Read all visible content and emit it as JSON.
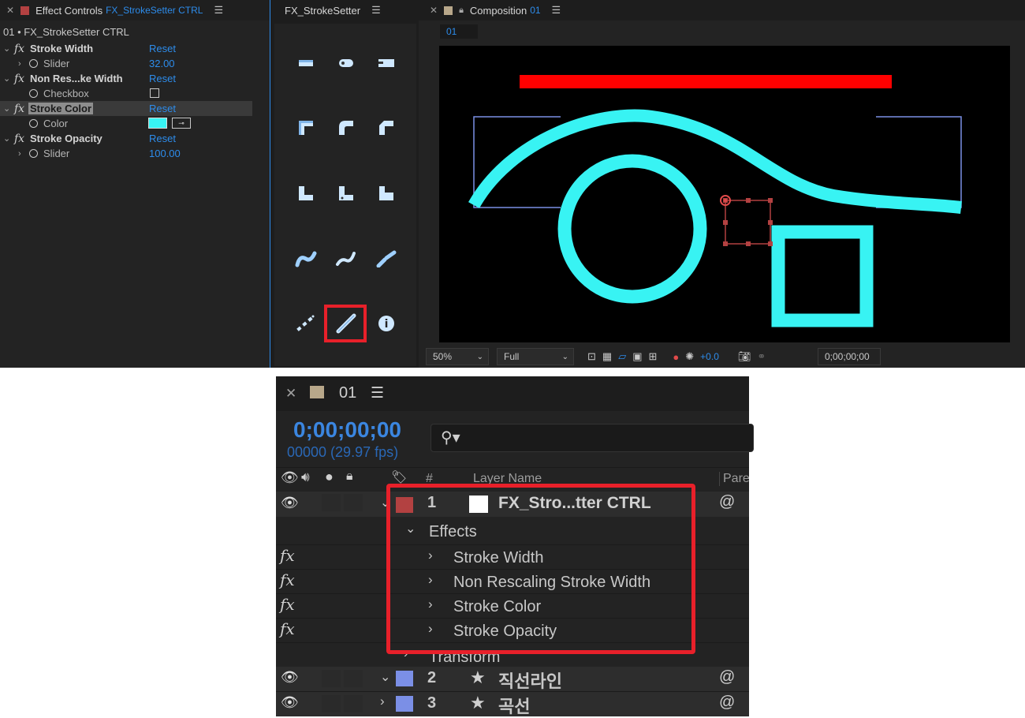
{
  "effect_controls": {
    "tab_label": "Effect Controls",
    "tab_layer": "FX_StrokeSetter CTRL",
    "layer_path": "01 • FX_StrokeSetter CTRL",
    "effects": [
      {
        "name": "Stroke Width",
        "reset": "Reset",
        "param": "Slider",
        "value": "32.00"
      },
      {
        "name": "Non Res...ke Width",
        "reset": "Reset",
        "param": "Checkbox",
        "value": ""
      },
      {
        "name": "Stroke Color",
        "reset": "Reset",
        "param": "Color",
        "value": ""
      },
      {
        "name": "Stroke Opacity",
        "reset": "Reset",
        "param": "Slider",
        "value": "100.00"
      }
    ],
    "color_swatch": "#38f3f3"
  },
  "fx_panel": {
    "title": "FX_StrokeSetter",
    "tools": [
      "cap-butt-icon",
      "cap-round-icon",
      "cap-square-icon",
      "join-miter-icon",
      "join-round-icon",
      "join-bevel-icon",
      "corner-1-icon",
      "corner-2-icon",
      "corner-3-icon",
      "stroke-taper-1-icon",
      "stroke-taper-2-icon",
      "stroke-taper-3-icon",
      "dashes-icon",
      "solid-line-icon",
      "info-icon"
    ],
    "selected_tool": "solid-line-icon",
    "highlight_color": "#e8202a"
  },
  "composition": {
    "tab_label": "Composition",
    "tab_name": "01",
    "sub_tab": "01",
    "zoom": "50%",
    "resolution": "Full",
    "exposure": "+0.0",
    "timecode": "0;00;00;00",
    "shape_color": "#38f3f3",
    "bar_color": "#ff0000"
  },
  "timeline": {
    "comp_name": "01",
    "timecode": "0;00;00;00",
    "frames": "00000 (29.97 fps)",
    "col_hash": "#",
    "col_layer_name": "Layer Name",
    "col_parent": "Pare",
    "layers": [
      {
        "num": "1",
        "name": "FX_Stro...tter CTRL",
        "color": "#b34141"
      },
      {
        "num": "2",
        "name": "직선라인",
        "color": "#7b8fe6"
      },
      {
        "num": "3",
        "name": "곡선",
        "color": "#7b8fe6"
      }
    ],
    "effects_group": "Effects",
    "effects": [
      "Stroke Width",
      "Non Rescaling Stroke Width",
      "Stroke Color",
      "Stroke Opacity"
    ],
    "transform": "Transform",
    "fx_symbol": "fx"
  }
}
